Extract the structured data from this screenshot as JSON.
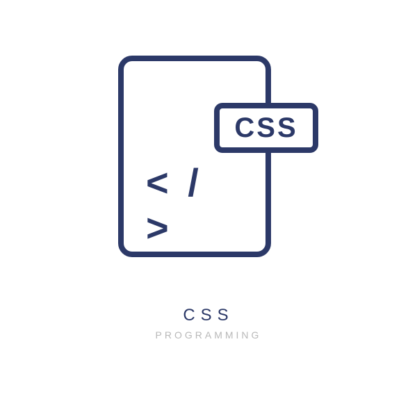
{
  "icon": {
    "badge_label": "CSS",
    "code_symbol": "< / >"
  },
  "caption": {
    "title": "CSS",
    "subtitle": "PROGRAMMING"
  }
}
